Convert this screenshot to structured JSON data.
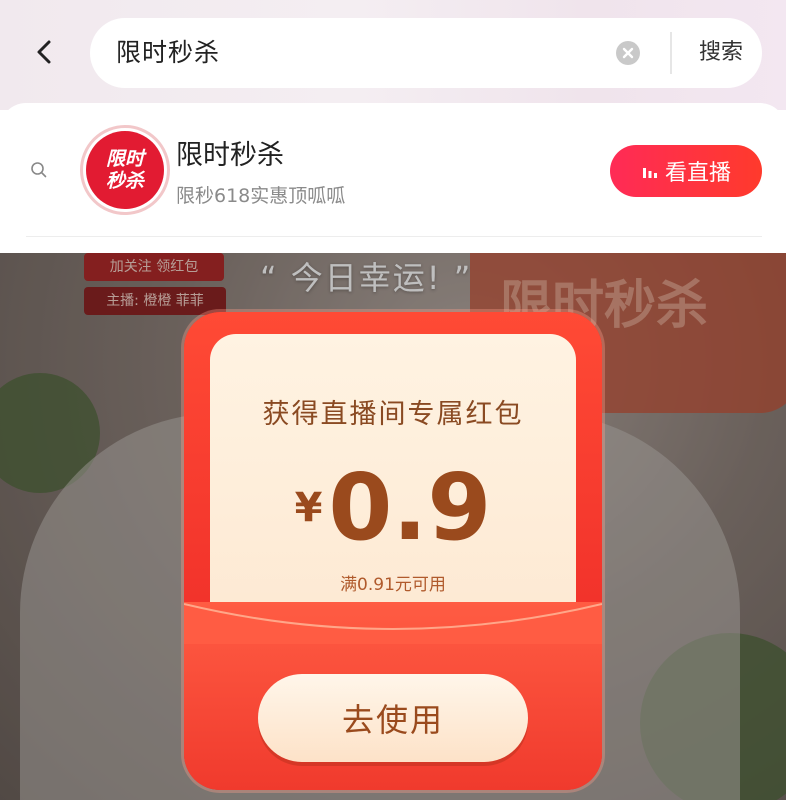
{
  "header": {
    "search_value": "限时秒杀",
    "search_button_label": "搜索"
  },
  "suggestion": {
    "logo_line1": "限时",
    "logo_line2": "秒杀",
    "title": "限时秒杀",
    "subtitle": "限秒618实惠顶呱呱",
    "live_button_label": "看直播"
  },
  "stream": {
    "tag_follow": "加关注 领红包",
    "tag_host": "主播: 橙橙 菲菲",
    "lucky_text": "“ 今日幸运! ”",
    "sign_text": "限时秒杀"
  },
  "red_packet": {
    "title": "获得直播间专属红包",
    "currency": "¥",
    "amount": "0.9",
    "condition": "满0.91元可用",
    "use_button_label": "去使用"
  },
  "colors": {
    "accent_red": "#f2332b",
    "live_button": "#ff2b56",
    "packet_card": "#fff3e2",
    "packet_text": "#9a4a1d"
  },
  "icons": {
    "back": "chevron-left-icon",
    "clear": "clear-icon",
    "suggest": "search-icon",
    "live": "live-bars-icon"
  }
}
